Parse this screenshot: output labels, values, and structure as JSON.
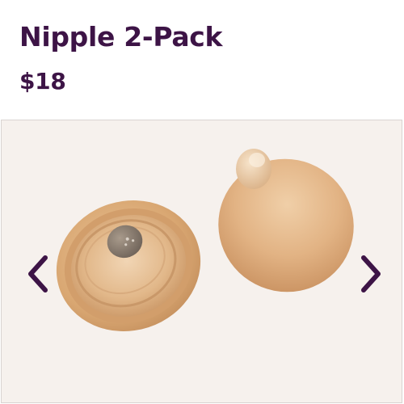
{
  "product": {
    "title": "Nipple 2-Pack",
    "price": "$18"
  },
  "gallery": {
    "background": "#f6f1ed",
    "prev_icon": "chevron-left-icon",
    "next_icon": "chevron-right-icon"
  },
  "colors": {
    "brand_text": "#3d1446",
    "arrow": "#3d1446",
    "product_tan": "#dba979"
  }
}
